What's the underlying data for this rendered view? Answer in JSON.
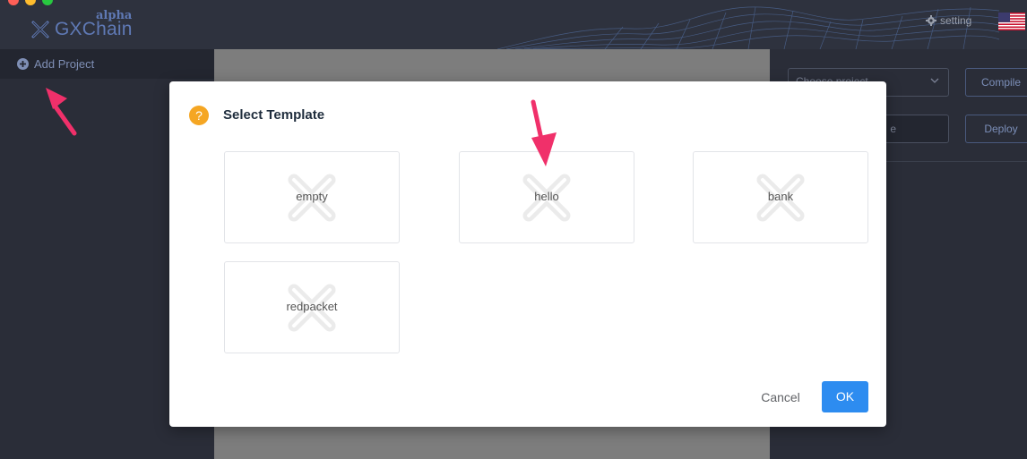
{
  "app": {
    "logo_text": "GXChain",
    "logo_badge": "alpha",
    "setting_label": "setting"
  },
  "sidebar": {
    "add_project_label": "Add Project"
  },
  "right_panel": {
    "project_select_placeholder": "Choose project",
    "compile_label": "Compile",
    "input_placeholder": "e",
    "deploy_label": "Deploy"
  },
  "modal": {
    "title": "Select Template",
    "templates": [
      {
        "label": "empty"
      },
      {
        "label": "hello"
      },
      {
        "label": "bank"
      },
      {
        "label": "redpacket"
      }
    ],
    "cancel_label": "Cancel",
    "ok_label": "OK"
  },
  "colors": {
    "accent": "#2d8cf0",
    "warning_icon": "#f5a623",
    "annotation_arrow": "#f0306a"
  },
  "icons": [
    "gxchain-logo-icon",
    "gear-icon",
    "us-flag-icon",
    "plus-circle-icon",
    "chevron-down-icon",
    "question-icon",
    "template-placeholder-icon",
    "annotation-arrow"
  ]
}
